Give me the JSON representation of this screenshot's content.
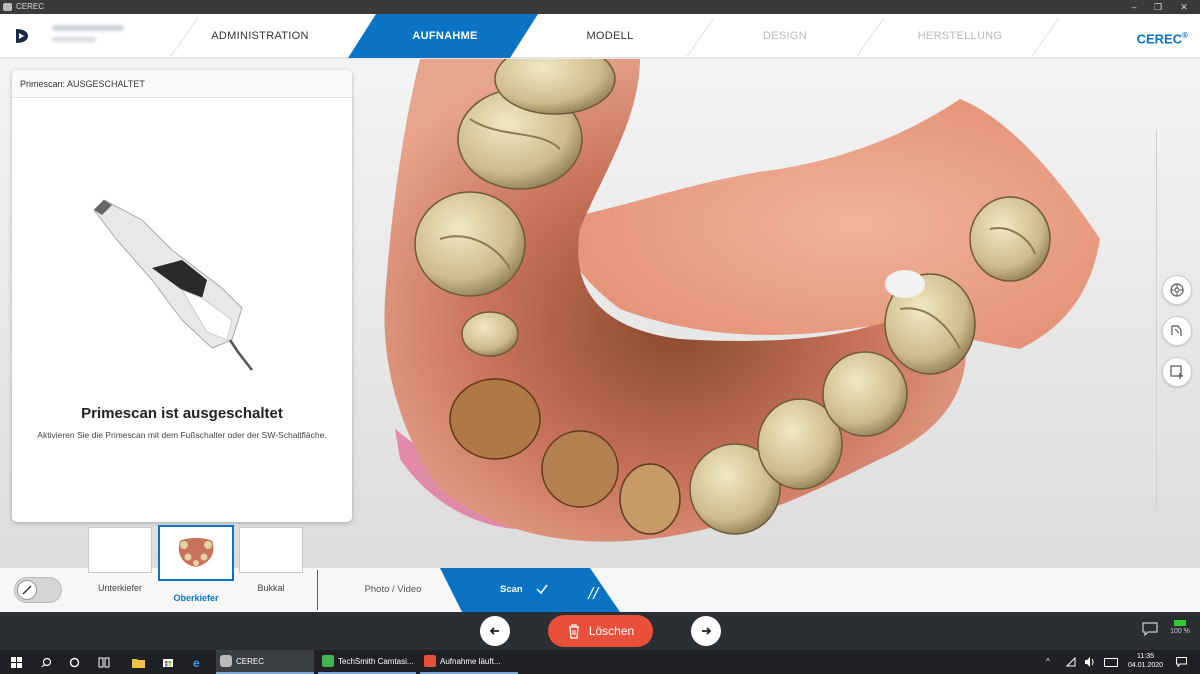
{
  "window": {
    "title": "CEREC",
    "minimize": "–",
    "restore": "❐",
    "close": "✕"
  },
  "nav": {
    "tabs": [
      {
        "label": "ADMINISTRATION",
        "state": "normal"
      },
      {
        "label": "AUFNAHME",
        "state": "active"
      },
      {
        "label": "MODELL",
        "state": "normal"
      },
      {
        "label": "DESIGN",
        "state": "disabled"
      },
      {
        "label": "HERSTELLUNG",
        "state": "disabled"
      }
    ],
    "brand": "CEREC",
    "brand_mark": "®"
  },
  "scanner_panel": {
    "header": "Primescan: AUSGESCHALTET",
    "title": "Primescan ist ausgeschaltet",
    "description": "Aktivieren Sie die Primescan mit dem Fußschalter oder der SW-Schaltfläche."
  },
  "tools": {
    "icons": [
      "palette-icon",
      "tooth-scan-icon",
      "add-selection-icon"
    ]
  },
  "scan_catalog": {
    "items": [
      {
        "label": "Unterkiefer",
        "active": false
      },
      {
        "label": "Oberkiefer",
        "active": true
      },
      {
        "label": "Bukkal",
        "active": false
      }
    ],
    "steps": [
      {
        "label": "Photo / Video"
      },
      {
        "label": "Scan"
      }
    ]
  },
  "actions": {
    "delete_label": "Löschen",
    "battery": "100 %"
  },
  "taskbar": {
    "apps": [
      {
        "label": "CEREC"
      },
      {
        "label": "TechSmith Camtasi..."
      },
      {
        "label": "Aufnahme läuft..."
      }
    ],
    "time": "11:35",
    "date": "04.01.2020"
  },
  "colors": {
    "accent": "#0a73c4",
    "delete": "#e8503a",
    "dark_bar": "#2b2e33"
  }
}
